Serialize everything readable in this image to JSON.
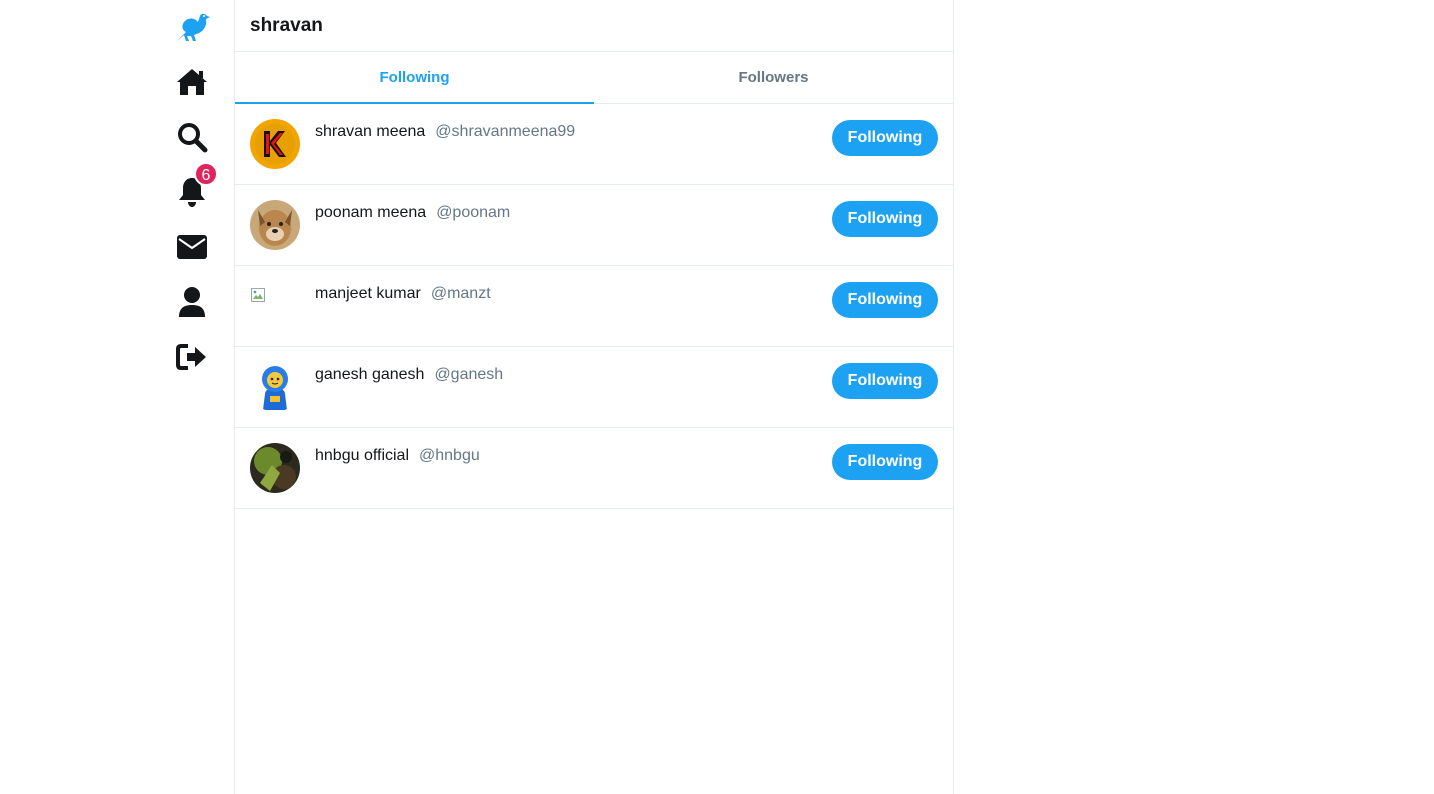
{
  "nav": {
    "items": [
      {
        "icon": "bird-logo-icon"
      },
      {
        "icon": "home-icon"
      },
      {
        "icon": "search-icon"
      },
      {
        "icon": "bell-icon",
        "badge": "6"
      },
      {
        "icon": "envelope-icon"
      },
      {
        "icon": "user-icon"
      },
      {
        "icon": "logout-icon"
      }
    ]
  },
  "header": {
    "title": "shravan"
  },
  "tabs": [
    {
      "label": "Following",
      "active": true
    },
    {
      "label": "Followers",
      "active": false
    }
  ],
  "users": [
    {
      "name": "shravan meena",
      "handle": "@shravanmeena99",
      "button": "Following",
      "avatar": "orange-k-logo"
    },
    {
      "name": "poonam meena",
      "handle": "@poonam",
      "button": "Following",
      "avatar": "dog-photo"
    },
    {
      "name": "manjeet kumar",
      "handle": "@manzt",
      "button": "Following",
      "avatar": "broken-image"
    },
    {
      "name": "ganesh ganesh",
      "handle": "@ganesh",
      "button": "Following",
      "avatar": "astronaut-figure"
    },
    {
      "name": "hnbgu official",
      "handle": "@hnbgu",
      "button": "Following",
      "avatar": "dark-photo"
    }
  ],
  "colors": {
    "accent": "#1da1f2",
    "badge": "#e0245e",
    "text": "#14171a",
    "muted": "#657786"
  }
}
